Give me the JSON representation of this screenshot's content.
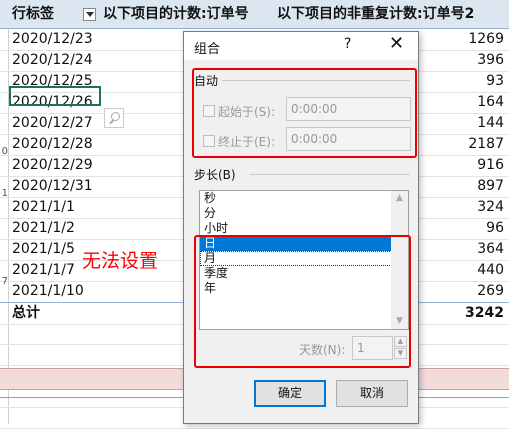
{
  "sheet": {
    "headers": {
      "row_labels": "行标签",
      "count_col": "以下项目的计数:订单号",
      "distinct_col": "以下项目的非重复计数:订单号2"
    },
    "rows": [
      {
        "label": "2020/12/23",
        "value": "1269"
      },
      {
        "label": "2020/12/24",
        "value": "396"
      },
      {
        "label": "2020/12/25",
        "value": "93"
      },
      {
        "label": "2020/12/26",
        "value": "164"
      },
      {
        "label": "2020/12/27",
        "value": "144"
      },
      {
        "label": "2020/12/28",
        "value": "2187"
      },
      {
        "label": "2020/12/29",
        "value": "916"
      },
      {
        "label": "2020/12/31",
        "value": "897"
      },
      {
        "label": "2021/1/1",
        "value": "324"
      },
      {
        "label": "2021/1/2",
        "value": "96"
      },
      {
        "label": "2021/1/5",
        "value": "364"
      },
      {
        "label": "2021/1/7",
        "value": "440"
      },
      {
        "label": "2021/1/10",
        "value": "269"
      }
    ],
    "total": {
      "label": "总计",
      "value": "3242"
    },
    "row_numbers": [
      "0",
      "1",
      "7"
    ]
  },
  "annotation": "无法设置",
  "dialog": {
    "title": "组合",
    "help": "?",
    "close": "✕",
    "auto_group": "自动",
    "start_label": "起始于(S):",
    "start_value": "0:00:00",
    "end_label": "终止于(E):",
    "end_value": "0:00:00",
    "step_label": "步长(B)",
    "step_items": [
      "秒",
      "分",
      "小时",
      "日",
      "月",
      "季度",
      "年"
    ],
    "selected_item": "日",
    "days_label": "天数(N):",
    "days_value": "1",
    "ok": "确定",
    "cancel": "取消"
  },
  "colors": {
    "accent": "#0078d7",
    "annotation": "#ff0000",
    "excel_green": "#217346"
  }
}
